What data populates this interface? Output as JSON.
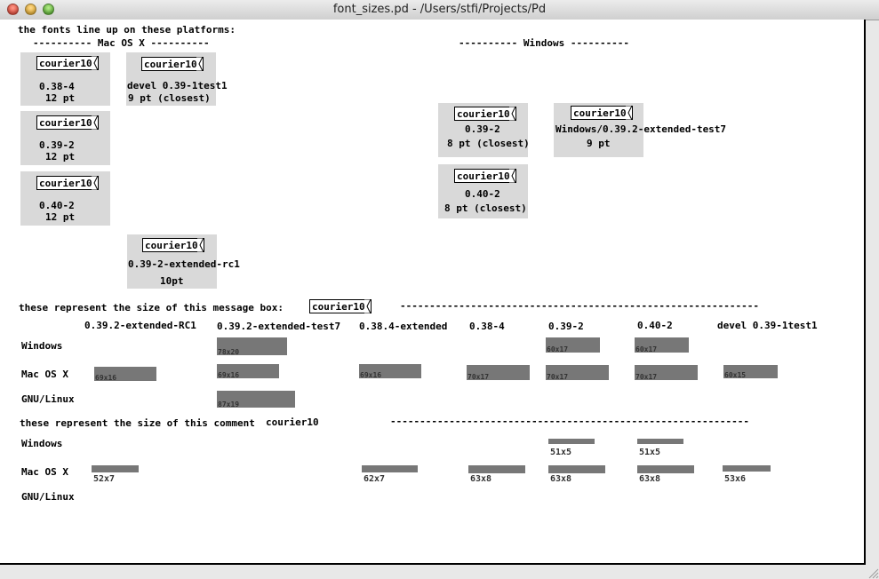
{
  "window": {
    "title": "font_sizes.pd  - /Users/stfi/Projects/Pd"
  },
  "header": {
    "intro": "the fonts line up on these platforms:",
    "mac_heading": "---------- Mac OS X ----------",
    "win_heading": "---------- Windows ----------"
  },
  "samples": {
    "msg_text": "courier10",
    "mac1": {
      "line1": "0.38-4",
      "line2": "12 pt"
    },
    "mac2": {
      "line1": "devel 0.39-1test1",
      "line2": "9 pt (closest)"
    },
    "mac3": {
      "line1": "0.39-2",
      "line2": "12 pt"
    },
    "mac4": {
      "line1": "0.40-2",
      "line2": "12 pt"
    },
    "mac5": {
      "line1": "0.39-2-extended-rc1",
      "line2": "10pt"
    },
    "win1": {
      "line1": "0.39-2",
      "line2": "8 pt (closest)"
    },
    "win2": {
      "line1": "Windows/0.39.2-extended-test7",
      "line2": "9 pt"
    },
    "win3": {
      "line1": "0.40-2",
      "line2": "8 pt (closest)"
    }
  },
  "msgsize": {
    "title": "these represent the size of this message box:",
    "dashes": "-------------------------------------------------------------",
    "columns": [
      "0.39.2-extended-RC1",
      "0.39.2-extended-test7",
      "0.38.4-extended",
      "0.38-4",
      "0.39-2",
      "0.40-2",
      "devel 0.39-1test1"
    ],
    "rows": [
      "Windows",
      "Mac OS X",
      "GNU/Linux"
    ],
    "cells": {
      "win_test7": "78x20",
      "win_039": "60x17",
      "win_040": "60x17",
      "mac_rc1": "69x16",
      "mac_test7": "69x16",
      "mac_0384ext": "69x16",
      "mac_0384": "70x17",
      "mac_039": "70x17",
      "mac_040": "70x17",
      "mac_devel": "60x15",
      "linux_test7": "87x19"
    }
  },
  "commentsize": {
    "title": "these represent the size of this comment",
    "comment_sample": "courier10",
    "dashes": "-------------------------------------------------------------",
    "rows": [
      "Windows",
      "Mac OS X",
      "GNU/Linux"
    ],
    "cells": {
      "win_039": "51x5",
      "win_040": "51x5",
      "mac_rc1": "52x7",
      "mac_0384ext": "62x7",
      "mac_0384": "63x8",
      "mac_039": "63x8",
      "mac_040": "63x8",
      "mac_devel": "53x6"
    }
  }
}
